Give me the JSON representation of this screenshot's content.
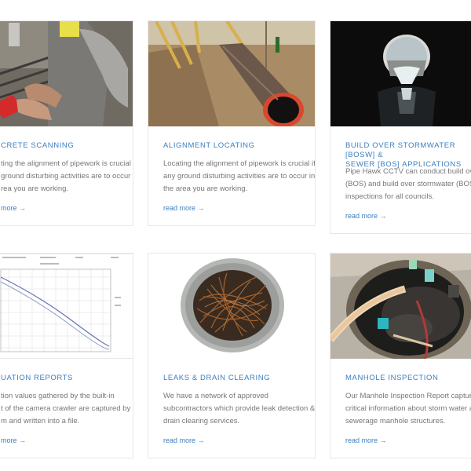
{
  "cards": [
    {
      "title": "CRETE SCANNING",
      "desc": [
        "ting the alignment of pipework is crucial if",
        "ground disturbing activities are to occur in",
        "rea you are working."
      ],
      "more": "more →"
    },
    {
      "title": "ALIGNMENT LOCATING",
      "desc": [
        "Locating the alignment of pipework is crucial if",
        "any ground disturbing activities are to occur in",
        "the area you are working."
      ],
      "more": "read more →"
    },
    {
      "title": "BUILD OVER STORMWATER [BOSW] &\nSEWER [BOS] APPLICATIONS",
      "desc": [
        "Pipe Hawk CCTV can conduct build over sew",
        "(BOS) and build over stormwater (BOSW)",
        "inspections for all councils."
      ],
      "more": "read more →"
    },
    {
      "title": "UATION REPORTS",
      "desc": [
        "tion values gathered by the built-in",
        "t of the camera crawler are captured by",
        "m and written into a file."
      ],
      "more": "more →"
    },
    {
      "title": "LEAKS & DRAIN CLEARING",
      "desc": [
        "We have a network of approved",
        "subcontractors which provide leak detection &",
        "drain clearing services."
      ],
      "more": "read more →"
    },
    {
      "title": "MANHOLE INSPECTION",
      "desc": [
        "Our Manhole Inspection Report captures",
        "critical information about storm water and",
        "sewerage manhole structures."
      ],
      "more": "read more →"
    }
  ],
  "colors": {
    "accent": "#3a7fc1",
    "text": "#777777",
    "border": "#e8e8e8"
  }
}
